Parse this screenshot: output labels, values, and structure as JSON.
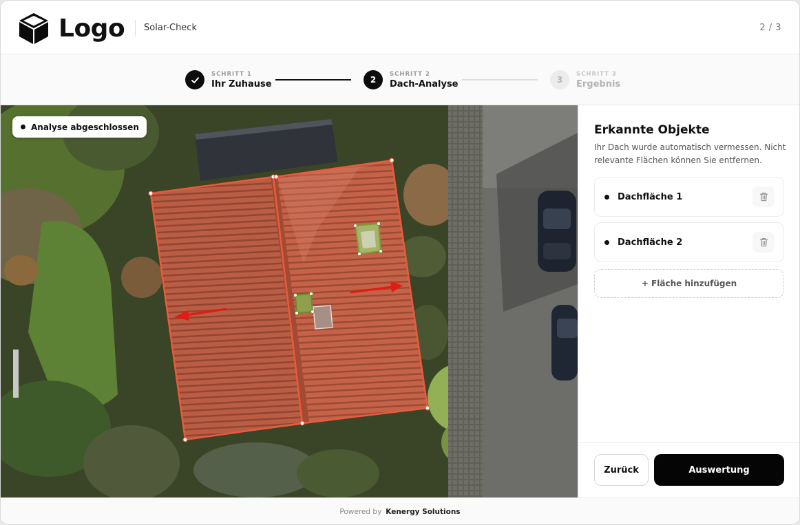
{
  "header": {
    "logo_text": "Logo",
    "app_name": "Solar-Check",
    "page_counter": "2 / 3"
  },
  "stepper": {
    "steps": [
      {
        "kicker": "SCHRITT 1",
        "title": "Ihr Zuhause",
        "state": "done",
        "marker": "✓"
      },
      {
        "kicker": "SCHRITT 2",
        "title": "Dach-Analyse",
        "state": "active",
        "marker": "2"
      },
      {
        "kicker": "SCHRITT 3",
        "title": "Ergebnis",
        "state": "upcoming",
        "marker": "3"
      }
    ]
  },
  "map": {
    "status_badge": "Analyse abgeschlossen"
  },
  "panel": {
    "title": "Erkannte Objekte",
    "description": "Ihr Dach wurde automatisch vermessen. Nicht relevante Flächen können Sie entfernen.",
    "objects": [
      {
        "label": "Dachfläche 1"
      },
      {
        "label": "Dachfläche 2"
      }
    ],
    "add_label": "+ Fläche hinzufügen",
    "back_label": "Zurück",
    "next_label": "Auswertung"
  },
  "footer": {
    "powered_by": "Powered by",
    "company": "Kenergy Solutions"
  },
  "colors": {
    "accent": "#050505",
    "roof": "#c9654a",
    "detection_outline": "#e8573a",
    "arrow": "#e21b14",
    "obstacle": "#9fbf4a"
  }
}
